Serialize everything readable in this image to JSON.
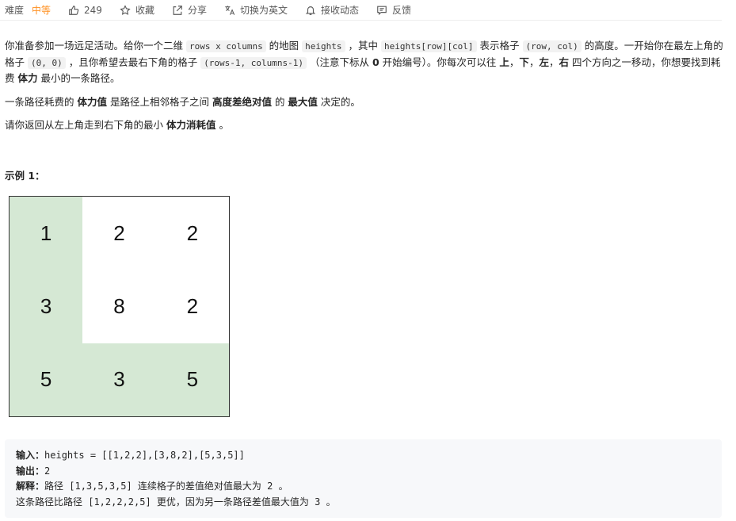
{
  "toolbar": {
    "difficulty_label": "难度",
    "difficulty_value": "中等",
    "like_count": "249",
    "favorite_label": "收藏",
    "share_label": "分享",
    "translate_label": "切换为英文",
    "subscribe_label": "接收动态",
    "feedback_label": "反馈"
  },
  "description": {
    "p1": [
      {
        "t": "你准备参加一场远足活动。给你一个二维 "
      },
      {
        "c": "rows x columns"
      },
      {
        "t": " 的地图 "
      },
      {
        "c": "heights"
      },
      {
        "t": " ，其中 "
      },
      {
        "c": "heights[row][col]"
      },
      {
        "t": " 表示格子 "
      },
      {
        "c": "(row, col)"
      },
      {
        "t": " 的高度。一开始你在最左上角的格子 "
      },
      {
        "c": "(0, 0)"
      },
      {
        "t": " ，且你希望去最右下角的格子 "
      },
      {
        "c": "(rows-1, columns-1)"
      },
      {
        "t": " （注意下标从 "
      },
      {
        "b": "0"
      },
      {
        "t": " 开始编号）。你每次可以往 "
      },
      {
        "b": "上"
      },
      {
        "t": "，"
      },
      {
        "b": "下"
      },
      {
        "t": "，"
      },
      {
        "b": "左"
      },
      {
        "t": "，"
      },
      {
        "b": "右"
      },
      {
        "t": " 四个方向之一移动，你想要找到耗费 "
      },
      {
        "b": "体力"
      },
      {
        "t": " 最小的一条路径。"
      }
    ],
    "p2": [
      {
        "t": "一条路径耗费的 "
      },
      {
        "b": "体力值"
      },
      {
        "t": " 是路径上相邻格子之间 "
      },
      {
        "b": "高度差绝对值"
      },
      {
        "t": " 的 "
      },
      {
        "b": "最大值"
      },
      {
        "t": " 决定的。"
      }
    ],
    "p3": [
      {
        "t": "请你返回从左上角走到右下角的最小 "
      },
      {
        "b": "体力消耗值"
      },
      {
        "t": " 。"
      }
    ]
  },
  "example": {
    "title": "示例 1：",
    "grid": [
      [
        "1",
        "2",
        "2"
      ],
      [
        "3",
        "8",
        "2"
      ],
      [
        "5",
        "3",
        "5"
      ]
    ],
    "highlight": [
      [
        true,
        false,
        false
      ],
      [
        true,
        false,
        false
      ],
      [
        true,
        true,
        true
      ]
    ],
    "highlight_color": "#d5e8d4",
    "input_label": "输入：",
    "input_value": "heights = [[1,2,2],[3,8,2],[5,3,5]]",
    "output_label": "输出：",
    "output_value": "2",
    "explain_label": "解释：",
    "explain_value": "路径 [1,3,5,3,5] 连续格子的差值绝对值最大为 2 。",
    "explain_line2": "这条路径比路径 [1,2,2,2,5] 更优，因为另一条路径差值最大值为 3 。"
  },
  "colors": {
    "difficulty_medium": "#ff8f1f",
    "code_bg": "#f7f8fa"
  },
  "icons": [
    "thumbs-up-icon",
    "star-icon",
    "share-icon",
    "translate-icon",
    "bell-icon",
    "feedback-icon"
  ]
}
